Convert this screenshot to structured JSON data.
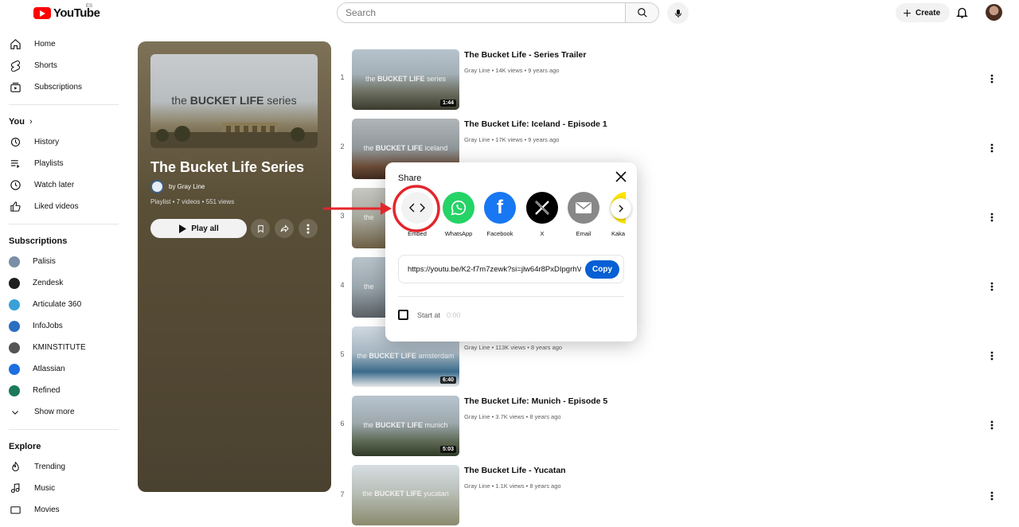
{
  "header": {
    "logo_text": "YouTube",
    "country": "ES",
    "search_placeholder": "Search",
    "create_label": "Create"
  },
  "sidebar": {
    "main": [
      {
        "label": "Home",
        "icon": "home-icon"
      },
      {
        "label": "Shorts",
        "icon": "shorts-icon"
      },
      {
        "label": "Subscriptions",
        "icon": "subscriptions-icon"
      }
    ],
    "you_title": "You",
    "you": [
      {
        "label": "History",
        "icon": "history-icon"
      },
      {
        "label": "Playlists",
        "icon": "playlists-icon"
      },
      {
        "label": "Watch later",
        "icon": "clock-icon"
      },
      {
        "label": "Liked videos",
        "icon": "thumb-up-icon"
      }
    ],
    "subs_title": "Subscriptions",
    "subscriptions": [
      {
        "label": "Palisis",
        "color": "#7a8fa6"
      },
      {
        "label": "Zendesk",
        "color": "#1f1f1f"
      },
      {
        "label": "Articulate 360",
        "color": "#3aa0d8"
      },
      {
        "label": "InfoJobs",
        "color": "#2b6fc2"
      },
      {
        "label": "KMINSTITUTE",
        "color": "#555555"
      },
      {
        "label": "Atlassian",
        "color": "#1d6fe0"
      },
      {
        "label": "Refined",
        "color": "#1a7a5a"
      }
    ],
    "show_more": "Show more",
    "explore_title": "Explore",
    "explore": [
      {
        "label": "Trending",
        "icon": "trending-icon"
      },
      {
        "label": "Music",
        "icon": "music-icon"
      },
      {
        "label": "Movies",
        "icon": "movies-icon"
      }
    ]
  },
  "playlist": {
    "thumb_text_pre": "the ",
    "thumb_text_bold": "BUCKET LIFE",
    "thumb_text_post": " series",
    "title": "The Bucket Life Series",
    "owner": "by Gray Line",
    "meta": "Playlist • 7 videos • 551 views",
    "play_all": "Play all"
  },
  "videos": [
    {
      "index": "1",
      "title": "The Bucket Life - Series Trailer",
      "meta": "Gray Line • 14K views • 9 years ago",
      "duration": "1:44",
      "thumb_pre": "the ",
      "thumb_bold": "BUCKET LIFE",
      "thumb_post": " series"
    },
    {
      "index": "2",
      "title": "The Bucket Life: Iceland - Episode 1",
      "meta": "Gray Line • 17K views • 9 years ago",
      "duration": "",
      "thumb_pre": "the ",
      "thumb_bold": "BUCKET LIFE",
      "thumb_post": " iceland"
    },
    {
      "index": "3",
      "title": "",
      "meta": "",
      "duration": "",
      "thumb_pre": "the",
      "thumb_bold": "",
      "thumb_post": ""
    },
    {
      "index": "4",
      "title": "",
      "meta": "",
      "duration": "",
      "thumb_pre": "the",
      "thumb_bold": "",
      "thumb_post": ""
    },
    {
      "index": "5",
      "title": "",
      "meta": "Gray Line • 113K views • 8 years ago",
      "duration": "6:40",
      "thumb_pre": "the ",
      "thumb_bold": "BUCKET LIFE",
      "thumb_post": " amsterdam"
    },
    {
      "index": "6",
      "title": "The Bucket Life: Munich - Episode 5",
      "meta": "Gray Line • 3.7K views • 8 years ago",
      "duration": "5:03",
      "thumb_pre": "the ",
      "thumb_bold": "BUCKET LIFE",
      "thumb_post": " munich"
    },
    {
      "index": "7",
      "title": "The Bucket Life - Yucatan",
      "meta": "Gray Line • 1.1K views • 8 years ago",
      "duration": "",
      "thumb_pre": "the ",
      "thumb_bold": "BUCKET LIFE",
      "thumb_post": " yucatan"
    }
  ],
  "share_modal": {
    "title": "Share",
    "targets": [
      {
        "label": "Embed",
        "icon": "embed-icon",
        "color": "#f2f2f2"
      },
      {
        "label": "WhatsApp",
        "icon": "whatsapp-icon",
        "color": "#25d366"
      },
      {
        "label": "Facebook",
        "icon": "facebook-icon",
        "color": "#1877f2"
      },
      {
        "label": "X",
        "icon": "x-icon",
        "color": "#000000"
      },
      {
        "label": "Email",
        "icon": "email-icon",
        "color": "#888888"
      },
      {
        "label": "Kaka",
        "icon": "kakao-icon",
        "color": "#fee500"
      }
    ],
    "url": "https://youtu.be/K2-f7m7zewk?si=jlw64r8PxDIpgrhV",
    "copy_label": "Copy",
    "start_at_label": "Start at",
    "start_time": "0:00"
  },
  "annotation_color": "#e3262c"
}
